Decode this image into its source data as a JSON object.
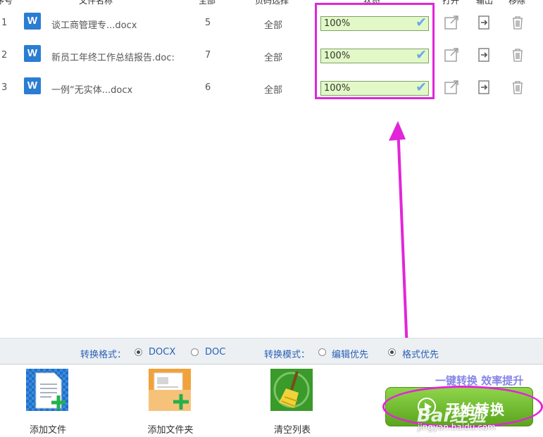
{
  "header": {
    "index": "序号",
    "filename": "文件名称",
    "pages": "全部",
    "range": "页码选择",
    "status": "状态",
    "open": "打开",
    "output": "输出",
    "remove": "移除"
  },
  "files": [
    {
      "index": "1",
      "icon": "W",
      "name": "谈工商管理专...docx",
      "pages": "5",
      "range": "全部",
      "progress": 100,
      "status": "100%"
    },
    {
      "index": "2",
      "icon": "W",
      "name": "新员工年终工作总结报告.doc:",
      "pages": "7",
      "range": "全部",
      "progress": 100,
      "status": "100%"
    },
    {
      "index": "3",
      "icon": "W",
      "name": "一例“无实体...docx",
      "pages": "6",
      "range": "全部",
      "progress": 100,
      "status": "100%"
    }
  ],
  "options": {
    "format_label": "转换格式：",
    "format_docx": "DOCX",
    "format_doc": "DOC",
    "format_selected": "DOCX",
    "mode_label": "转换模式：",
    "mode_edit": "编辑优先",
    "mode_layout": "格式优先",
    "mode_selected": "格式优先"
  },
  "toolbar": {
    "add_file": "添加文件",
    "add_folder": "添加文件夹",
    "clear_list": "清空列表",
    "slogan": "一键转换  效率提升",
    "start": "开始转换"
  },
  "watermark": {
    "brand": "Bai经验",
    "url": "jingyan.baidu.com"
  },
  "colors": {
    "annotation": "#e225d9",
    "progress_fill": "#e2f9c7",
    "start_button": "#6cbd2c",
    "word_icon": "#2b7cd3",
    "link_blue": "#2a5fb5"
  }
}
